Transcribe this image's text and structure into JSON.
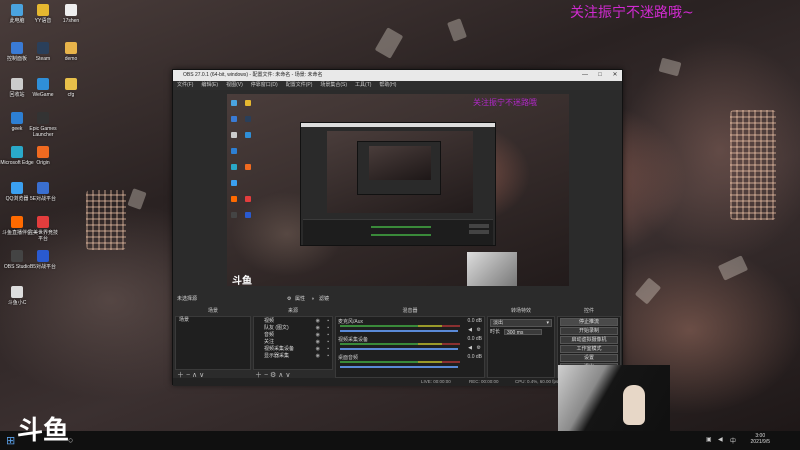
{
  "desktop": {
    "banner": "关注振宁不迷路哦~",
    "icons": [
      {
        "label": "此电脑",
        "color": "#4aa3df"
      },
      {
        "label": "YY语音",
        "color": "#e6b830"
      },
      {
        "label": "17shen",
        "color": "#eeeeee"
      },
      {
        "label": "控制面板",
        "color": "#3a7bd5"
      },
      {
        "label": "Steam",
        "color": "#2a3f5a"
      },
      {
        "label": "demo",
        "color": "#e8b44a"
      },
      {
        "label": "回收站",
        "color": "#cccccc"
      },
      {
        "label": "WeGame",
        "color": "#2f8fd8"
      },
      {
        "label": "cfg",
        "color": "#e8c04a"
      },
      {
        "label": "geek",
        "color": "#2d7fd3"
      },
      {
        "label": "Epic Games Launcher",
        "color": "#333333"
      },
      {
        "label": "Microsoft Edge",
        "color": "#2aa9c9"
      },
      {
        "label": "Origin",
        "color": "#f06a20"
      },
      {
        "label": "QQ浏览器",
        "color": "#3ba0f0"
      },
      {
        "label": "5E对战平台",
        "color": "#3a6fd0"
      },
      {
        "label": "斗鱼直播伴侣",
        "color": "#ff6a00"
      },
      {
        "label": "完美世界竞技平台",
        "color": "#e33d3d"
      },
      {
        "label": "OBS Studio",
        "color": "#444444"
      },
      {
        "label": "B5对战平台",
        "color": "#2a5ad0"
      },
      {
        "label": "斗鱼小C",
        "color": "#dddddd"
      }
    ],
    "logo": "斗鱼"
  },
  "obs": {
    "title": "OBS 27.0.1 (64-bit, windows) - 配置文件: 未命名 - 场景: 未命名",
    "menu": [
      "文件(F)",
      "编辑(E)",
      "视图(V)",
      "停靠窗口(D)",
      "配置文件(P)",
      "场景集合(S)",
      "工具(T)",
      "帮助(H)"
    ],
    "preview_banner": "关注振宁不迷路哦",
    "preview_logo": "斗鱼",
    "mode_label": "未选择源",
    "mode_options": [
      "属性",
      "滤镜"
    ],
    "docks": {
      "scenes": "场景",
      "sources": "来源",
      "mixer": "混音器",
      "transitions": "转场特效",
      "controls": "控件"
    },
    "scenes": [
      "场景"
    ],
    "sources": [
      "视频",
      "队友 (图文)",
      "音频",
      "关注",
      "视频采集设备",
      "显示器采集"
    ],
    "mixer": [
      {
        "name": "麦克风/Aux",
        "db": "0.0 dB"
      },
      {
        "name": "视频采集设备",
        "db": "0.0 dB"
      },
      {
        "name": "桌面音频",
        "db": "0.0 dB"
      }
    ],
    "transitions": {
      "type": "淡出",
      "duration_label": "时长",
      "duration": "300 ms"
    },
    "controls": [
      "停止推流",
      "开始录制",
      "启动虚拟摄像机",
      "工作室模式",
      "设置",
      "退出"
    ],
    "status": {
      "live": "LIVE: 00:00:00",
      "rec": "REC: 00:00:00",
      "cpu": "CPU: 0.4%, 60.00 fps"
    }
  },
  "taskbar": {
    "time": "3:00",
    "date": "2021/9/5"
  }
}
